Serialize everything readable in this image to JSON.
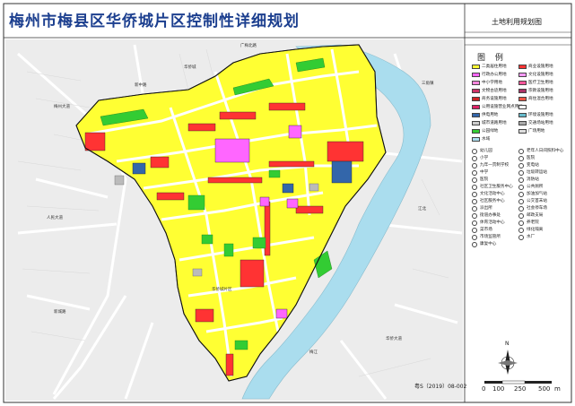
{
  "title": "梅州市梅县区华侨城片区控制性详细规划",
  "subtitle": "土地利用规划图",
  "legend": {
    "title": "图 例",
    "color_items": [
      {
        "label": "二类居住用地",
        "color": "#ffff33"
      },
      {
        "label": "商业设施用地",
        "color": "#ff3333"
      },
      {
        "label": "行政办公用地",
        "color": "#ff66ff"
      },
      {
        "label": "文化设施用地",
        "color": "#ff99ff"
      },
      {
        "label": "中小学用地",
        "color": "#ff88dd"
      },
      {
        "label": "医疗卫生用地",
        "color": "#ff5599"
      },
      {
        "label": "文物古迹用地",
        "color": "#cc3366"
      },
      {
        "label": "宗教设施用地",
        "color": "#aa3366"
      },
      {
        "label": "商务设施用地",
        "color": "#cc2222"
      },
      {
        "label": "商住混合用地",
        "color": "#ee5544"
      },
      {
        "label": "公用设施营业网点用地",
        "color": "#dd2266"
      },
      {
        "label": "",
        "color": "#ffffff"
      },
      {
        "label": "供电用地",
        "color": "#3366aa"
      },
      {
        "label": "环境设施用地",
        "color": "#66bbcc"
      },
      {
        "label": "城市道路用地",
        "color": "#cccccc"
      },
      {
        "label": "交通场站用地",
        "color": "#aaaaaa"
      },
      {
        "label": "公园绿地",
        "color": "#33cc33"
      },
      {
        "label": "广场用地",
        "color": "#dddddd"
      },
      {
        "label": "水域",
        "color": "#aaddee"
      }
    ],
    "symbol_items": [
      {
        "label": "幼儿园",
        "icon": "kindergarten-icon"
      },
      {
        "label": "老年人日间照料中心",
        "icon": "elderly-center-icon"
      },
      {
        "label": "小学",
        "icon": "primary-school-icon"
      },
      {
        "label": "医院",
        "icon": "hospital-icon"
      },
      {
        "label": "九年一贯制学校",
        "icon": "school-icon"
      },
      {
        "label": "变电站",
        "icon": "substation-icon"
      },
      {
        "label": "中学",
        "icon": "middle-school-icon"
      },
      {
        "label": "垃圾转运站",
        "icon": "waste-station-icon"
      },
      {
        "label": "医院",
        "icon": "clinic-icon"
      },
      {
        "label": "消防站",
        "icon": "fire-station-icon"
      },
      {
        "label": "社区卫生服务中心",
        "icon": "health-center-icon"
      },
      {
        "label": "公共厕所",
        "icon": "toilet-icon"
      },
      {
        "label": "文化活动中心",
        "icon": "culture-center-icon"
      },
      {
        "label": "加油加气站",
        "icon": "gas-station-icon"
      },
      {
        "label": "社区服务中心",
        "icon": "community-center-icon"
      },
      {
        "label": "公交首末站",
        "icon": "bus-terminal-icon"
      },
      {
        "label": "派出所",
        "icon": "police-icon"
      },
      {
        "label": "社会停车场",
        "icon": "parking-icon"
      },
      {
        "label": "街道办事处",
        "icon": "subdistrict-office-icon"
      },
      {
        "label": "邮政支局",
        "icon": "post-office-icon"
      },
      {
        "label": "体育活动中心",
        "icon": "sports-center-icon"
      },
      {
        "label": "养老院",
        "icon": "nursing-home-icon"
      },
      {
        "label": "菜市场",
        "icon": "market-icon"
      },
      {
        "label": "绿化隔离",
        "icon": "green-buffer-icon"
      },
      {
        "label": "市场监管所",
        "icon": "regulation-icon"
      },
      {
        "label": "水厂",
        "icon": "water-plant-icon"
      },
      {
        "label": "康复中心",
        "icon": "rehab-center-icon"
      }
    ]
  },
  "map": {
    "place_labels": [
      "华侨城",
      "广梅北路",
      "新中路",
      "梅州大道",
      "三角镇",
      "人民大道",
      "新城路",
      "华侨城片区",
      "梅江",
      "江北",
      "华侨大道"
    ],
    "roads": [
      "广梅北路",
      "梅州大道",
      "人民大道",
      "新中路"
    ]
  },
  "north_label": "N",
  "scale": {
    "ticks": [
      "0",
      "100",
      "250",
      "500"
    ],
    "unit": "m"
  },
  "drawing_code": "粤S（2019）08-002",
  "colors": {
    "title": "#1c3f8f",
    "residential": "#ffff33",
    "commercial": "#ff3333",
    "green": "#33cc33",
    "water": "#aaddee",
    "road": "#ffffff",
    "background": "#ececec"
  }
}
